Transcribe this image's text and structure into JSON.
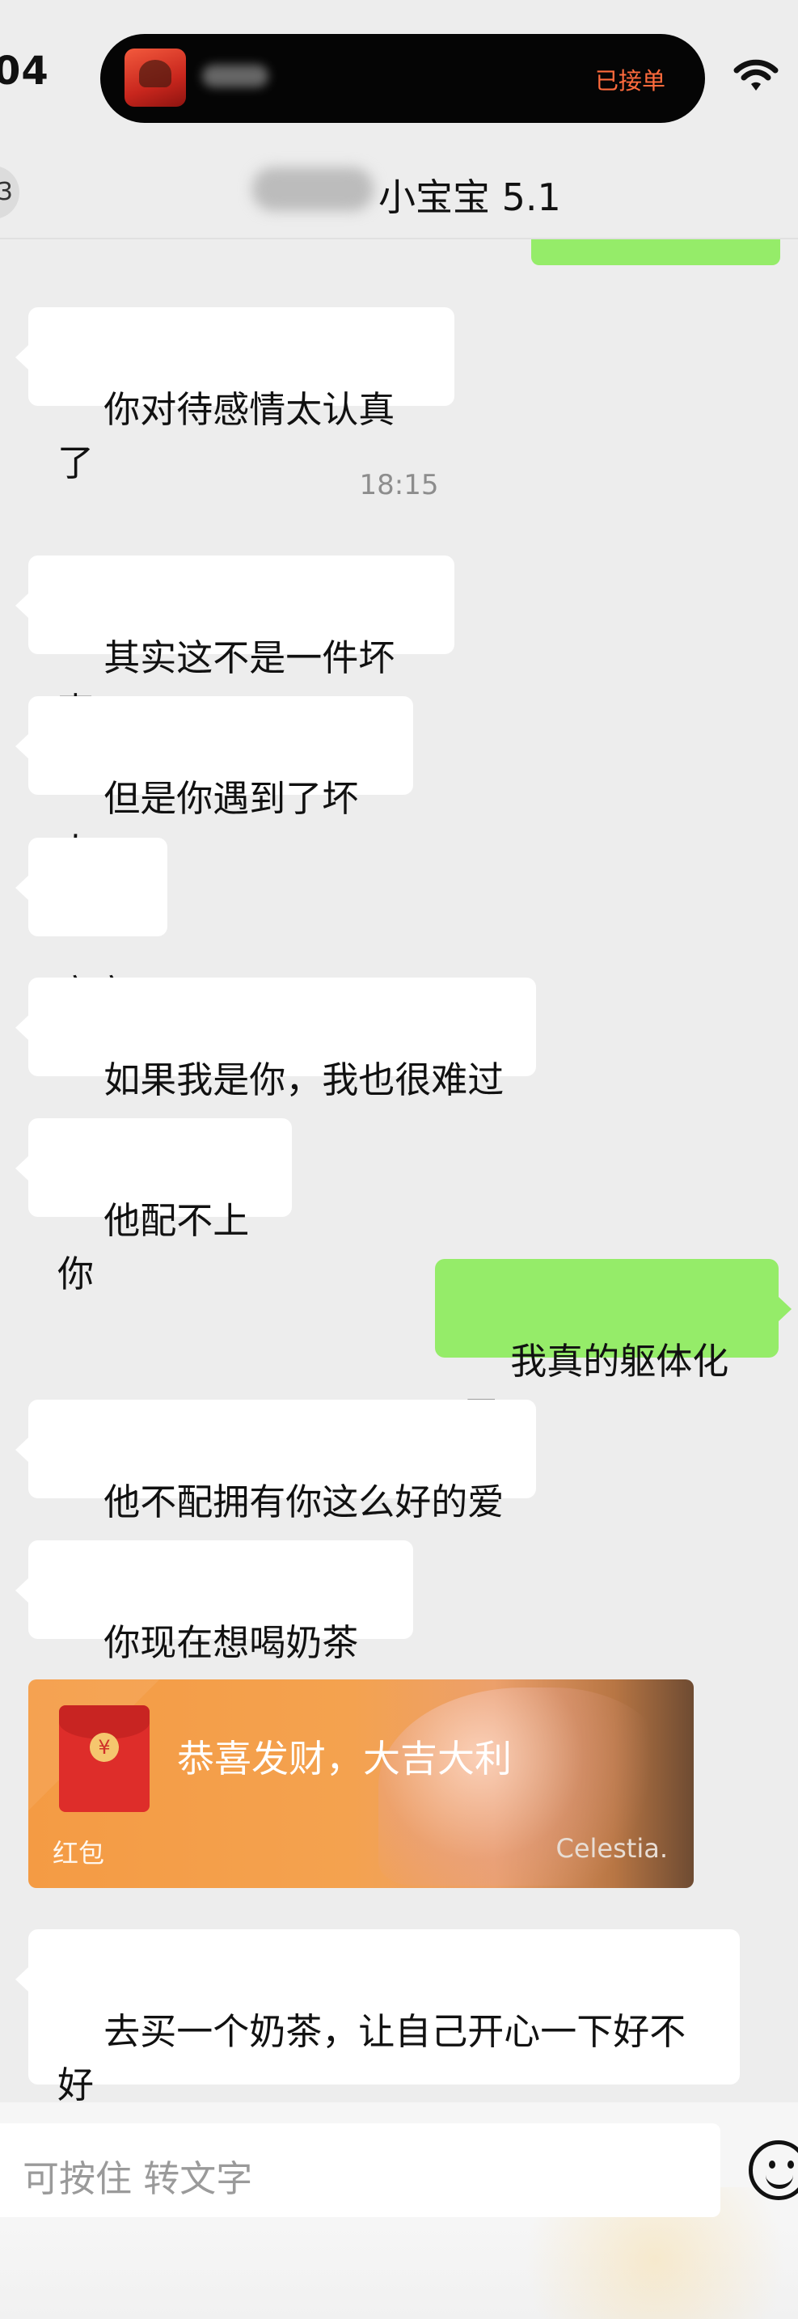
{
  "status_bar": {
    "time": "04",
    "island_status": "已接单"
  },
  "header": {
    "back_badge": "3",
    "chat_title": "小宝宝 5.1"
  },
  "chat": {
    "messages": [
      {
        "text": "你对待感情太认真了"
      },
      {
        "timestamp": "18:15"
      },
      {
        "text": "其实这不是一件坏事"
      },
      {
        "text": "但是你遇到了坏人"
      },
      {
        "text": "宝宝"
      },
      {
        "text": "如果我是你，我也很难过"
      },
      {
        "text": "他配不上你"
      },
      {
        "text": "我真的躯体化了"
      },
      {
        "text": "他不配拥有你这么好的爱"
      },
      {
        "text": "你现在想喝奶茶吗"
      },
      {
        "red_packet": {
          "title": "恭喜发财，大吉大利",
          "label": "红包",
          "sender": "Celestia."
        }
      },
      {
        "text": "去买一个奶茶，让自己开心一下好不\n好"
      }
    ]
  },
  "input": {
    "placeholder": "可按住 转文字"
  },
  "icons": {
    "wifi": "wifi-icon",
    "emoji": "smile-icon",
    "coin": "yuan-icon"
  },
  "colors": {
    "background": "#ededed",
    "outgoing_bubble": "#95ec69",
    "incoming_bubble": "#ffffff",
    "red_packet": "#f59b42",
    "island_status": "#ff6b3d"
  }
}
